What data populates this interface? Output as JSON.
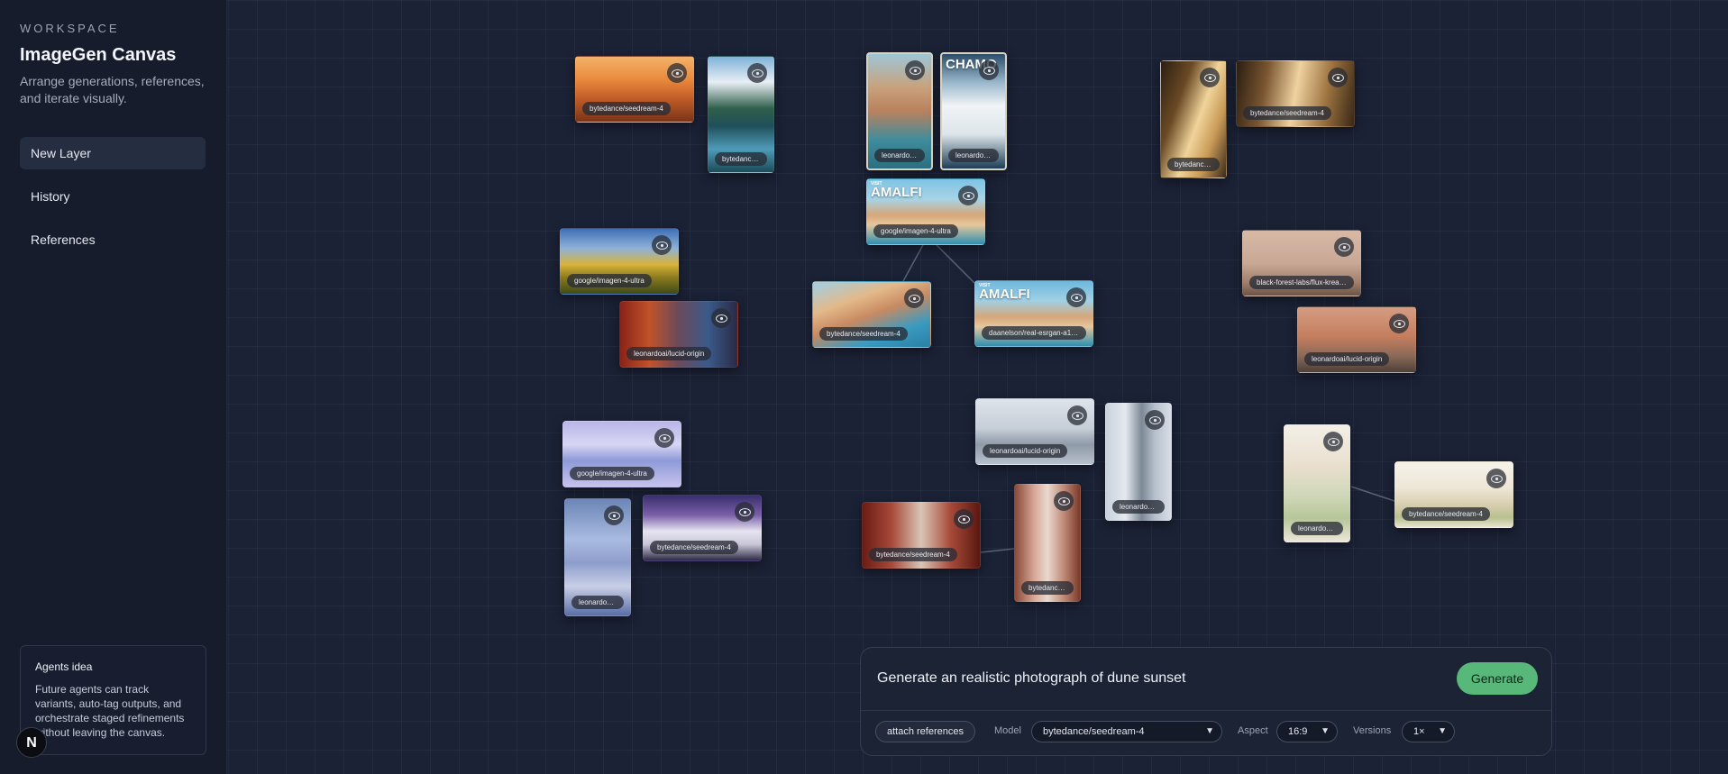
{
  "sidebar": {
    "workspace_label": "WORKSPACE",
    "title": "ImageGen Canvas",
    "subtitle": "Arrange generations, references, and iterate visually.",
    "nav": [
      {
        "label": "New Layer",
        "active": true
      },
      {
        "label": "History",
        "active": false
      },
      {
        "label": "References",
        "active": false
      }
    ],
    "agents_card": {
      "title": "Agents idea",
      "text": "Future agents can track variants, auto-tag outputs, and orchestrate staged refinements without leaving the canvas."
    },
    "badge": "N"
  },
  "canvas": {
    "cards": [
      {
        "id": "c1",
        "model": "bytedance/seedream-4",
        "subject": "desert dune sunset",
        "overlay": ""
      },
      {
        "id": "c2",
        "model": "bytedance/...",
        "subject": "mountain lake reflection",
        "overlay": ""
      },
      {
        "id": "c3",
        "model": "leonardoai/...",
        "subject": "cliffside coastal village",
        "overlay": ""
      },
      {
        "id": "c4",
        "model": "leonardoai/...",
        "subject": "Chamonix ski poster",
        "overlay": "CHAMO"
      },
      {
        "id": "c5",
        "model": "bytedance/...",
        "subject": "window curtain light",
        "overlay": ""
      },
      {
        "id": "c6",
        "model": "bytedance/seedream-4",
        "subject": "window curtain wide",
        "overlay": ""
      },
      {
        "id": "c7",
        "model": "google/imagen-4-ultra",
        "subject": "Visit Amalfi poster",
        "overlay": "AMALFI",
        "overlay_small": "VISIT"
      },
      {
        "id": "c8",
        "model": "google/imagen-4-ultra",
        "subject": "sunflower field painting",
        "overlay": ""
      },
      {
        "id": "c9",
        "model": "leonardoai/lucid-origin",
        "subject": "rainy street painting",
        "overlay": ""
      },
      {
        "id": "c10",
        "model": "bytedance/seedream-4",
        "subject": "Amalfi coast",
        "overlay": ""
      },
      {
        "id": "c11",
        "model": "daanelson/real-esrgan-a100...",
        "subject": "Visit Amalfi poster upscaled",
        "overlay": "AMALFI",
        "overlay_small": "VISIT"
      },
      {
        "id": "c12",
        "model": "black-forest-labs/flux-krea-dev",
        "subject": "bicycle against wall",
        "overlay": ""
      },
      {
        "id": "c13",
        "model": "leonardoai/lucid-origin",
        "subject": "bicycle against red wall",
        "overlay": ""
      },
      {
        "id": "c14",
        "model": "google/imagen-4-ultra",
        "subject": "whales in sky",
        "overlay": ""
      },
      {
        "id": "c15",
        "model": "leonardoai/...",
        "subject": "whale over water",
        "overlay": ""
      },
      {
        "id": "c16",
        "model": "bytedance/seedream-4",
        "subject": "snowy road night",
        "overlay": ""
      },
      {
        "id": "c17",
        "model": "leonardoai/lucid-origin",
        "subject": "foggy pyramid",
        "overlay": ""
      },
      {
        "id": "c18",
        "model": "leonardoai/...",
        "subject": "glass skyscraper",
        "overlay": ""
      },
      {
        "id": "c19",
        "model": "bytedance/seedream-4",
        "subject": "red interior doorway",
        "overlay": ""
      },
      {
        "id": "c20",
        "model": "bytedance/...",
        "subject": "pink interior doorway",
        "overlay": ""
      },
      {
        "id": "c21",
        "model": "leonardoai/...",
        "subject": "wildflower bouquet",
        "overlay": ""
      },
      {
        "id": "c22",
        "model": "bytedance/seedream-4",
        "subject": "wildflower meadow",
        "overlay": ""
      }
    ]
  },
  "prompt": {
    "text": "Generate an realistic photograph of dune sunset",
    "generate_label": "Generate",
    "attach_label": "attach references",
    "model_label": "Model",
    "model_value": "bytedance/seedream-4",
    "aspect_label": "Aspect",
    "aspect_value": "16:9",
    "versions_label": "Versions",
    "versions_value": "1×"
  },
  "colors": {
    "accent_green": "#57b87a",
    "background": "#1b2236",
    "sidebar": "#161c2c"
  }
}
